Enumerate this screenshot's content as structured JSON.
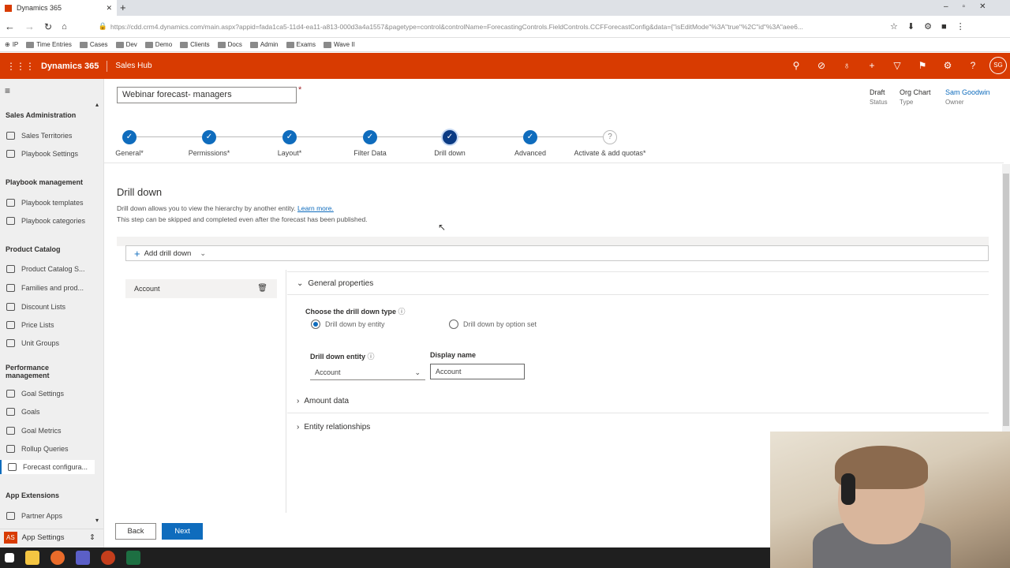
{
  "browser": {
    "tab_title": "Dynamics 365",
    "new_tab": "+",
    "url": "https://cdd.crm4.dynamics.com/main.aspx?appid=fada1ca5-11d4-ea11-a813-000d3a4a1557&pagetype=control&controlName=ForecastingControls.FieldControls.CCFForecastConfig&data={\"isEditMode\"%3A\"true\"%2C\"id\"%3A\"aee6...",
    "bookmarks": [
      "IP",
      "Time Entries",
      "Cases",
      "Dev",
      "Demo",
      "Clients",
      "Docs",
      "Admin",
      "Exams",
      "Wave II"
    ]
  },
  "header": {
    "brand": "Dynamics 365",
    "app": "Sales Hub",
    "avatar": "SG",
    "icons": [
      "search-icon",
      "task-icon",
      "lightbulb-icon",
      "plus-icon",
      "filter-icon",
      "assistant-icon",
      "settings-icon",
      "help-icon"
    ]
  },
  "sidebar": {
    "groups": [
      {
        "label": "Sales Administration",
        "items": [
          "Sales Territories",
          "Playbook Settings"
        ]
      },
      {
        "label": "Playbook management",
        "items": [
          "Playbook templates",
          "Playbook categories"
        ]
      },
      {
        "label": "Product Catalog",
        "items": [
          "Product Catalog S...",
          "Families and prod...",
          "Discount Lists",
          "Price Lists",
          "Unit Groups"
        ]
      },
      {
        "label": "Performance management",
        "items": [
          "Goal Settings",
          "Goals",
          "Goal Metrics",
          "Rollup Queries",
          "Forecast configura..."
        ]
      },
      {
        "label": "App Extensions",
        "items": [
          "Partner Apps"
        ]
      }
    ],
    "area_badge": "AS",
    "area_label": "App Settings"
  },
  "form": {
    "name": "Webinar forecast- managers",
    "required_mark": "*",
    "status_value": "Draft",
    "status_label": "Status",
    "type_value": "Org Chart",
    "type_label": "Type",
    "owner_value": "Sam Goodwin",
    "owner_label": "Owner"
  },
  "steps": [
    {
      "label": "General*",
      "state": "done"
    },
    {
      "label": "Permissions*",
      "state": "done"
    },
    {
      "label": "Layout*",
      "state": "done"
    },
    {
      "label": "Filter Data",
      "state": "done"
    },
    {
      "label": "Drill down",
      "state": "current"
    },
    {
      "label": "Advanced",
      "state": "done"
    },
    {
      "label": "Activate & add quotas*",
      "state": "pending"
    }
  ],
  "drill": {
    "title": "Drill down",
    "desc1": "Drill down allows you to view the hierarchy by another entity.",
    "learn_more": "Learn more.",
    "desc2": "This step can be skipped and completed even after the forecast has been published.",
    "add_label": "Add drill down",
    "list_item": "Account",
    "general_section": "General properties",
    "type_label": "Choose the drill down type",
    "radio_entity": "Drill down by entity",
    "radio_option": "Drill down by option set",
    "entity_label": "Drill down entity",
    "entity_value": "Account",
    "display_label": "Display name",
    "display_value": "Account",
    "amount_section": "Amount data",
    "relationships_section": "Entity relationships"
  },
  "footer": {
    "back": "Back",
    "next": "Next"
  },
  "colors": {
    "header": "#d83b01",
    "accent": "#0f6cbd"
  }
}
